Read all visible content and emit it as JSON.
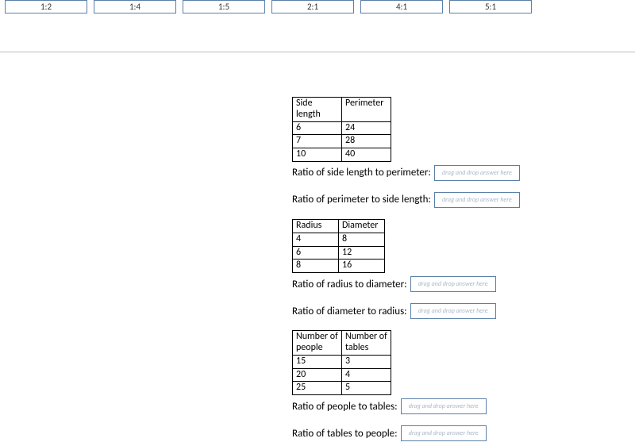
{
  "answer_bank": {
    "tiles": [
      "1:2",
      "1:4",
      "1:5",
      "2:1",
      "4:1",
      "5:1"
    ]
  },
  "dropzone_placeholder": "drag and drop answer here",
  "section1": {
    "headers": [
      "Side length",
      "Perimeter"
    ],
    "rows": [
      [
        "6",
        "24"
      ],
      [
        "7",
        "28"
      ],
      [
        "10",
        "40"
      ]
    ],
    "prompt_a": "Ratio of side length to perimeter:",
    "prompt_b": "Ratio of perimeter to side length:"
  },
  "section2": {
    "headers": [
      "Radius",
      "Diameter"
    ],
    "rows": [
      [
        "4",
        "8"
      ],
      [
        "6",
        "12"
      ],
      [
        "8",
        "16"
      ]
    ],
    "prompt_a": "Ratio of radius to diameter:",
    "prompt_b": "Ratio of diameter to radius:"
  },
  "section3": {
    "headers": [
      "Number of people",
      "Number of tables"
    ],
    "rows": [
      [
        "15",
        "3"
      ],
      [
        "20",
        "4"
      ],
      [
        "25",
        "5"
      ]
    ],
    "prompt_a": "Ratio of people to tables:",
    "prompt_b": "Ratio of tables to people:"
  }
}
